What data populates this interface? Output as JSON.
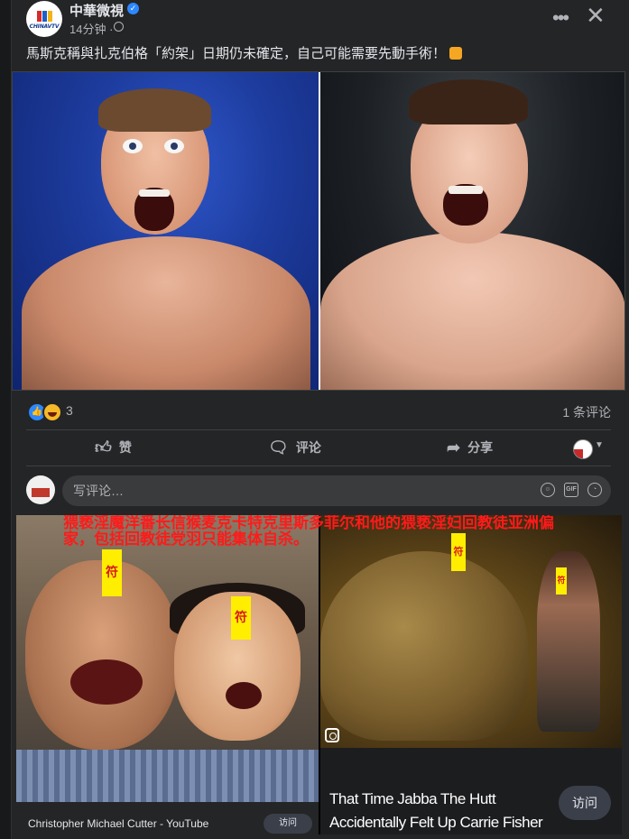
{
  "post": {
    "page_name": "中華微視",
    "logo_text": "CHINAVTV",
    "time": "14分钟 ·",
    "text": "馬斯克稱與扎克伯格「約架」日期仍未確定，自己可能需要先動手術！"
  },
  "stats": {
    "reaction_count": "3",
    "comment_count": "1 条评论"
  },
  "actions": {
    "like": "赞",
    "comment": "评论",
    "share": "分享"
  },
  "composer": {
    "placeholder": "写评论…",
    "gif": "GIF"
  },
  "comment_image": {
    "red_headline": "猥亵淫魔洋番长信猴麦克卡特克里斯多菲尔和他的猥亵淫妇回教徒亚洲偏家，包括回教徒党羽只能集体自杀。",
    "talisman": "符",
    "link_title": "That Time Jabba The Hutt Accidentally Felt Up Carrie Fisher On The Set Of The Retur...",
    "link_source": "Christopher Michael Cutter - YouTube",
    "visit_label": "访问"
  },
  "colors": {
    "background": "#18191a",
    "card": "#242526",
    "accent": "#2d88ff",
    "text_secondary": "#b0b3b8"
  }
}
